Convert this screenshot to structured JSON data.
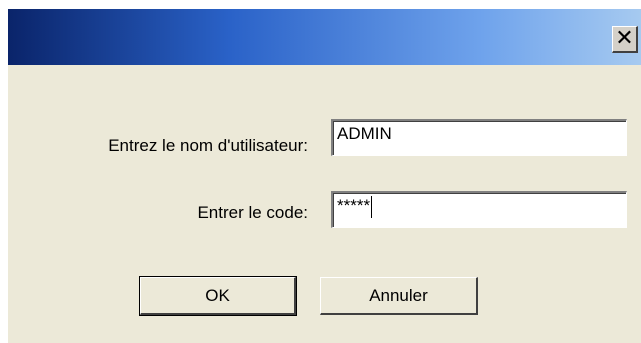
{
  "dialog": {
    "title": "",
    "close_symbol": "✕",
    "username_label": "Entrez le nom d'utilisateur:",
    "username_value": "ADMIN",
    "code_label": "Entrer le code:",
    "code_value": "*****",
    "ok_label": "OK",
    "cancel_label": "Annuler"
  },
  "colors": {
    "titlebar_start": "#0A246A",
    "titlebar_end": "#A6CAF0",
    "dialog_background": "#ECE9D8"
  },
  "icons": {
    "close": "close-icon"
  }
}
